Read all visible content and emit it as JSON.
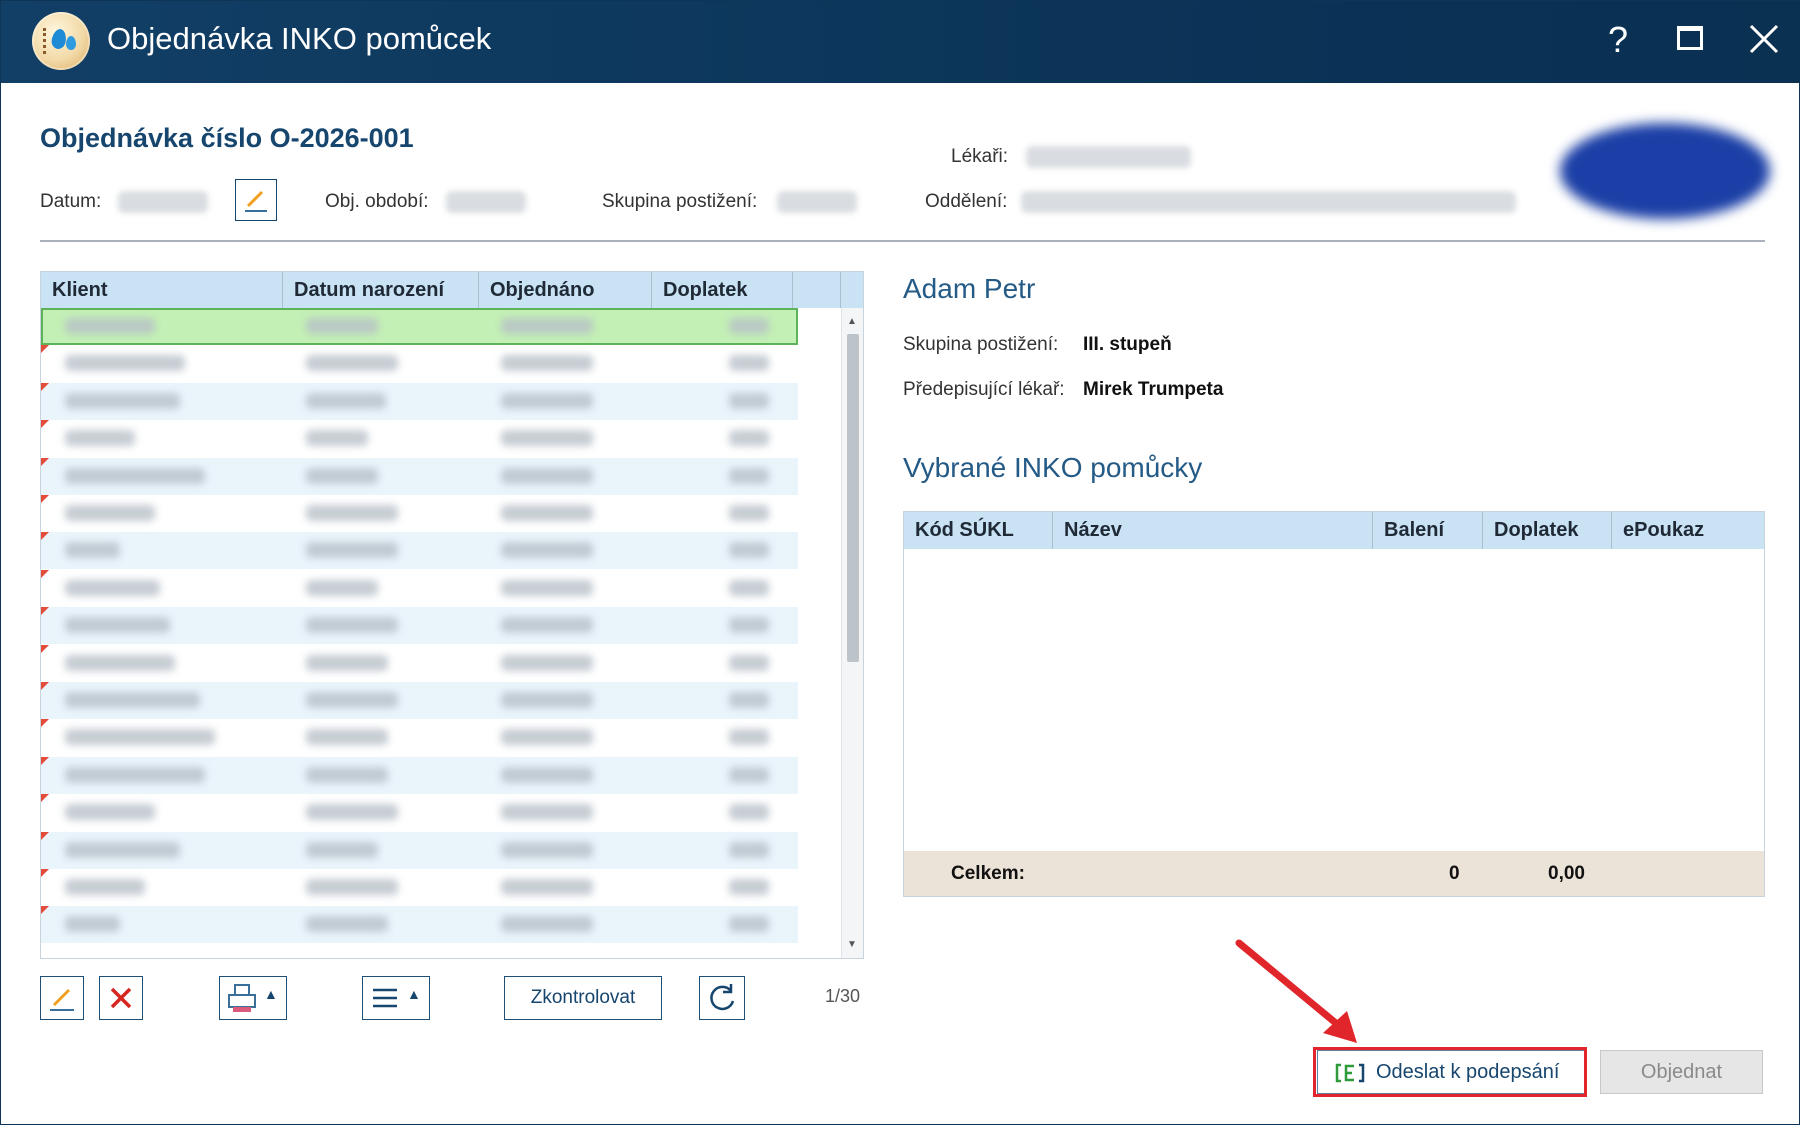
{
  "window": {
    "title": "Objednávka INKO pomůcek",
    "help_glyph": "?",
    "app_icon": "droplets-notebook-icon"
  },
  "header": {
    "order_title": "Objednávka číslo O-2026-001",
    "date_label": "Datum:",
    "period_label": "Obj. období:",
    "disability_group_label": "Skupina postižení:",
    "doctors_label": "Lékaři:",
    "department_label": "Oddělení:"
  },
  "clients_table": {
    "columns": [
      "Klient",
      "Datum narození",
      "Objednáno",
      "Doplatek"
    ],
    "row_count_visible": 17,
    "selected_row": 0,
    "pager": "1/30"
  },
  "toolbar": {
    "check_label": "Zkontrolovat"
  },
  "client_detail": {
    "name": "Adam Petr",
    "group_label": "Skupina postižení:",
    "group_value": "III. stupeň",
    "doctor_label": "Předepisující lékař:",
    "doctor_value": "Mirek Trumpeta"
  },
  "selected_aids": {
    "title": "Vybrané INKO pomůcky",
    "columns": [
      "Kód SÚKL",
      "Název",
      "Balení",
      "Doplatek",
      "ePoukaz"
    ],
    "rows": [],
    "total_label": "Celkem:",
    "total_packages": "0",
    "total_copay": "0,00"
  },
  "actions": {
    "send_to_sign_label": "Odeslat k podepsání",
    "order_label": "Objednat"
  },
  "colors": {
    "titlebar": "#0b3458",
    "accent_text": "#16456e",
    "table_header": "#c9e2f4",
    "selected_row": "#c3f0b5",
    "total_row": "#ece3d8",
    "highlight": "#e0262b"
  }
}
